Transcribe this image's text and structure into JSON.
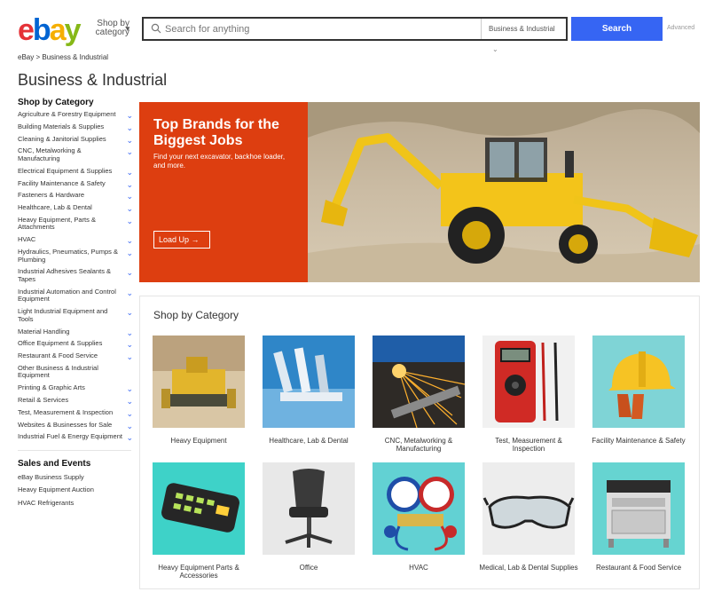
{
  "header": {
    "logo_letters": [
      "e",
      "b",
      "a",
      "y"
    ],
    "shop_by_category": "Shop by category",
    "search_placeholder": "Search for anything",
    "search_category": "Business & Industrial",
    "search_button": "Search",
    "advanced": "Advanced"
  },
  "breadcrumb": "eBay > Business & Industrial",
  "page_title": "Business & Industrial",
  "sidebar": {
    "heading": "Shop by Category",
    "items": [
      {
        "label": "Agriculture & Forestry Equipment",
        "chevron": true
      },
      {
        "label": "Building Materials & Supplies",
        "chevron": true
      },
      {
        "label": "Cleaning & Janitorial Supplies",
        "chevron": true
      },
      {
        "label": "CNC, Metalworking & Manufacturing",
        "chevron": true
      },
      {
        "label": "Electrical Equipment & Supplies",
        "chevron": true
      },
      {
        "label": "Facility Maintenance & Safety",
        "chevron": true
      },
      {
        "label": "Fasteners & Hardware",
        "chevron": true
      },
      {
        "label": "Healthcare, Lab & Dental",
        "chevron": true
      },
      {
        "label": "Heavy Equipment, Parts & Attachments",
        "chevron": true
      },
      {
        "label": "HVAC",
        "chevron": true
      },
      {
        "label": "Hydraulics, Pneumatics, Pumps & Plumbing",
        "chevron": true
      },
      {
        "label": "Industrial Adhesives Sealants & Tapes",
        "chevron": true
      },
      {
        "label": "Industrial Automation and Control Equipment",
        "chevron": true
      },
      {
        "label": "Light Industrial Equipment and Tools",
        "chevron": true
      },
      {
        "label": "Material Handling",
        "chevron": true
      },
      {
        "label": "Office Equipment & Supplies",
        "chevron": true
      },
      {
        "label": "Restaurant & Food Service",
        "chevron": true
      },
      {
        "label": "Other Business & Industrial Equipment",
        "chevron": false
      },
      {
        "label": "Printing & Graphic Arts",
        "chevron": true
      },
      {
        "label": "Retail & Services",
        "chevron": true
      },
      {
        "label": "Test, Measurement & Inspection",
        "chevron": true
      },
      {
        "label": "Websites & Businesses for Sale",
        "chevron": true
      },
      {
        "label": "Industrial Fuel & Energy Equipment",
        "chevron": true
      }
    ],
    "sales_heading": "Sales and Events",
    "sales_items": [
      "eBay Business Supply",
      "Heavy Equipment Auction",
      "HVAC Refrigerants"
    ]
  },
  "banner": {
    "title": "Top Brands for the Biggest Jobs",
    "subtitle": "Find your next excavator, backhoe loader, and more.",
    "button": "Load Up →"
  },
  "categories": {
    "heading": "Shop by Category",
    "tiles": [
      {
        "label": "Heavy Equipment",
        "icon": "bulldozer-image"
      },
      {
        "label": "Healthcare, Lab & Dental",
        "icon": "microscope-image"
      },
      {
        "label": "CNC, Metalworking & Manufacturing",
        "icon": "grinder-sparks-image"
      },
      {
        "label": "Test, Measurement & Inspection",
        "icon": "multimeter-image"
      },
      {
        "label": "Facility Maintenance & Safety",
        "icon": "hard-hat-image"
      },
      {
        "label": "Heavy Equipment Parts & Accessories",
        "icon": "control-panel-image"
      },
      {
        "label": "Office",
        "icon": "office-chair-image"
      },
      {
        "label": "HVAC",
        "icon": "manifold-gauge-image"
      },
      {
        "label": "Medical, Lab & Dental Supplies",
        "icon": "safety-glasses-image"
      },
      {
        "label": "Restaurant & Food Service",
        "icon": "stove-image"
      }
    ]
  },
  "colors": {
    "accent": "#3665f3",
    "banner_orange": "#dd3e10",
    "logo_red": "#e53238",
    "logo_blue": "#0064d2",
    "logo_yellow": "#f5af02",
    "logo_green": "#86b817"
  }
}
